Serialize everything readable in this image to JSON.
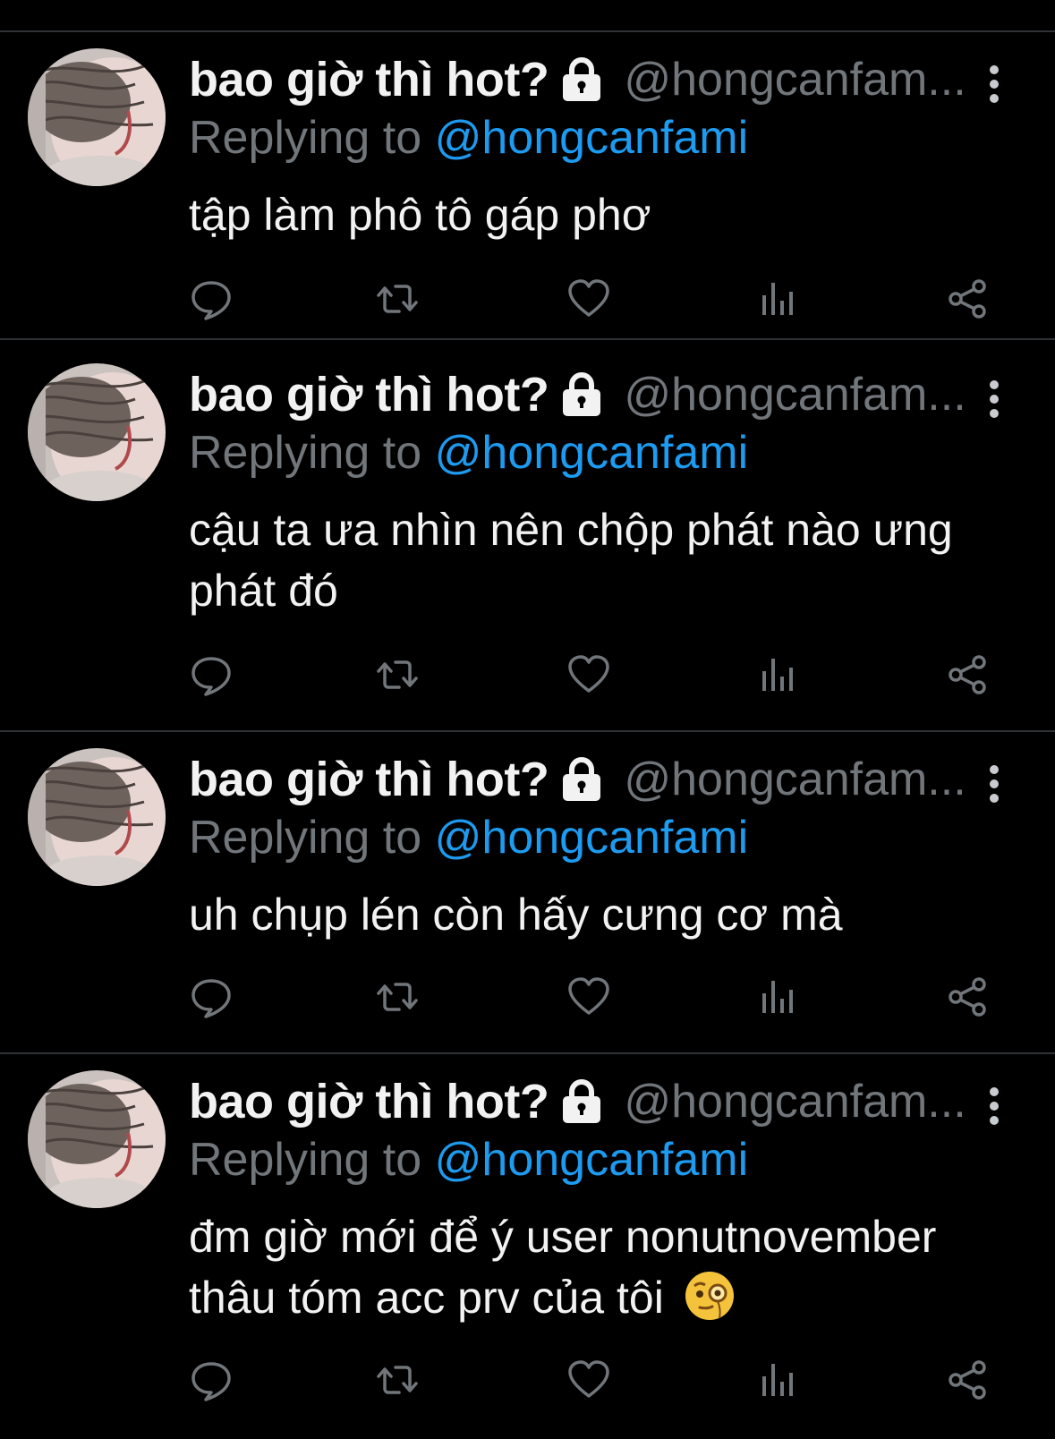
{
  "colors": {
    "background": "#000000",
    "divider": "#2f3336",
    "primary_text": "#f2f2f2",
    "secondary_text": "#71767b",
    "accent_link": "#1d9bf0"
  },
  "icons": {
    "avatar": "profile-photo",
    "lock": "lock-icon",
    "more": "vertical-ellipsis-icon",
    "reply": "reply-bubble-icon",
    "retweet": "retweet-icon",
    "like": "heart-icon",
    "views": "bar-chart-icon",
    "share": "share-icon",
    "emoji": "face-with-monocle"
  },
  "tweets": [
    {
      "display_name": "bao giờ thì hot?",
      "handle": "@hongcanfam...",
      "reply_prefix": "Replying to",
      "reply_to": "@hongcanfami",
      "text": "tập làm phô tô gáp phơ"
    },
    {
      "display_name": "bao giờ thì hot?",
      "handle": "@hongcanfam...",
      "reply_prefix": "Replying to",
      "reply_to": "@hongcanfami",
      "text": "cậu ta ưa nhìn nên chộp phát nào ưng phát đó"
    },
    {
      "display_name": "bao giờ thì hot?",
      "handle": "@hongcanfam...",
      "reply_prefix": "Replying to",
      "reply_to": "@hongcanfami",
      "text": "uh chụp lén còn hấy cưng cơ mà"
    },
    {
      "display_name": "bao giờ thì hot?",
      "handle": "@hongcanfam...",
      "reply_prefix": "Replying to",
      "reply_to": "@hongcanfami",
      "text": "đm giờ mới để ý user nonutnovember thâu tóm acc prv của tôi"
    }
  ]
}
